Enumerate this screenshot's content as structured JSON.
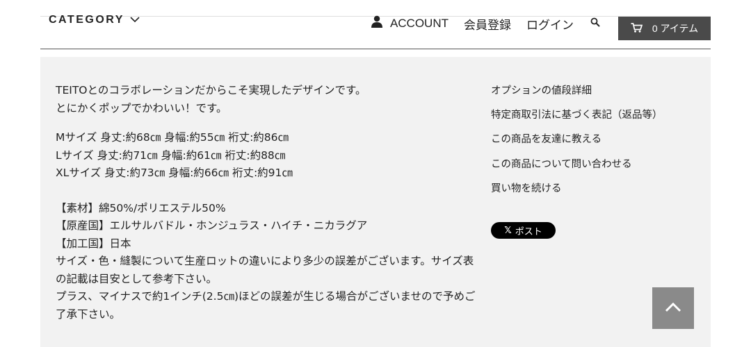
{
  "header": {
    "category_label": "CATEGORY",
    "account_label": "ACCOUNT",
    "register_label": "会員登録",
    "login_label": "ログイン",
    "cart_label": "0 アイテム"
  },
  "description": {
    "intro": [
      "TEITOとのコラボレーションだからこそ実現したデザインです。",
      "とにかくポップでかわいい！です。"
    ],
    "sizes": [
      "Mサイズ 身丈:約68㎝ 身幅:約55㎝ 裄丈:約86㎝",
      "Lサイズ 身丈:約71㎝ 身幅:約61㎝ 裄丈:約88㎝",
      "XLサイズ 身丈:約73㎝ 身幅:約66㎝ 裄丈:約91㎝"
    ],
    "details": [
      "【素材】綿50%/ポリエステル50%",
      "【原産国】エルサルバドル・ホンジュラス・ハイチ・ニカラグア",
      "【加工国】日本",
      "サイズ・色・縫製について生産ロットの違いにより多少の誤差がございます。サイズ表の記載は目安として参考下さい。",
      "プラス、マイナスで約1インチ(2.5㎝)ほどの誤差が生じる場合がございませので予めご了承下さい。"
    ]
  },
  "links": [
    "オプションの値段詳細",
    "特定商取引法に基づく表記（返品等）",
    "この商品を友達に教える",
    "この商品について問い合わせる",
    "買い物を続ける"
  ],
  "share": {
    "post_label": "ポスト",
    "x_glyph": "𝕏"
  },
  "icons": {
    "category": "chevron-down-icon",
    "account": "user-icon",
    "search": "search-icon",
    "cart": "cart-icon",
    "to_top": "chevron-up-icon"
  },
  "colors": {
    "cart_bg": "#4a4a4a",
    "panel_bg": "#f2f2f2",
    "to_top_bg": "#8a8a8a"
  }
}
